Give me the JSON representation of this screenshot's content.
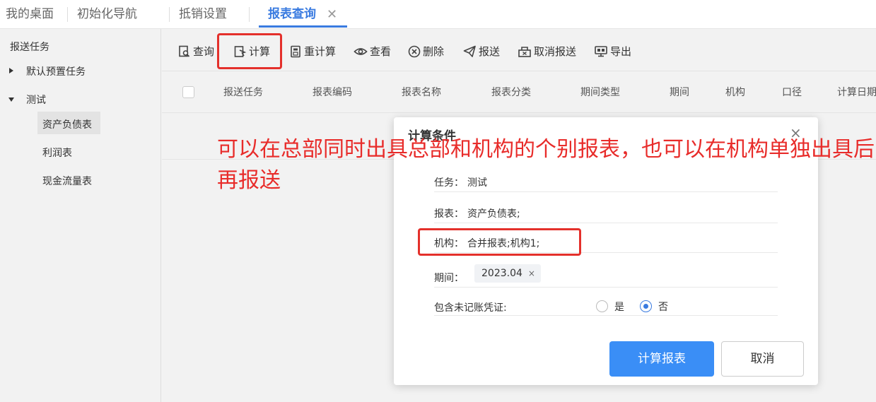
{
  "tabs": [
    {
      "label": "我的桌面"
    },
    {
      "label": "初始化导航"
    },
    {
      "label": "抵销设置"
    },
    {
      "label": "报表查询"
    }
  ],
  "tab_close": "✕",
  "sidebar": {
    "header": "报送任务",
    "groups": [
      {
        "label": "默认预置任务"
      },
      {
        "label": "测试"
      }
    ],
    "items": [
      {
        "label": "资产负债表"
      },
      {
        "label": "利润表"
      },
      {
        "label": "现金流量表"
      }
    ]
  },
  "toolbar": {
    "query": "查询",
    "calculate": "计算",
    "recalculate": "重计算",
    "view": "查看",
    "delete": "删除",
    "submit": "报送",
    "cancel_submit": "取消报送",
    "export": "导出"
  },
  "table": {
    "columns": [
      "报送任务",
      "报表编码",
      "报表名称",
      "报表分类",
      "期间类型",
      "期间",
      "机构",
      "口径",
      "计算日期"
    ]
  },
  "annotation": "可以在总部同时出具总部和机构的个别报表，也可以在机构单独出具后再报送",
  "dialog": {
    "title": "计算条件",
    "close": "×",
    "task_label": "任务：",
    "task_value": "测试",
    "report_label": "报表：",
    "report_value": "资产负债表;",
    "org_label": "机构：",
    "org_value": "合并报表;机构1;",
    "period_label": "期间：",
    "period_tag": "2023.04",
    "period_tag_remove": "×",
    "include_label": "包含未记账凭证:",
    "yes": "是",
    "no": "否",
    "selected": "否",
    "confirm": "计算报表",
    "cancel": "取消"
  },
  "colors": {
    "accent": "#3a7be0",
    "primary_button": "#3a8ef6",
    "annotation": "#e82c2a"
  }
}
